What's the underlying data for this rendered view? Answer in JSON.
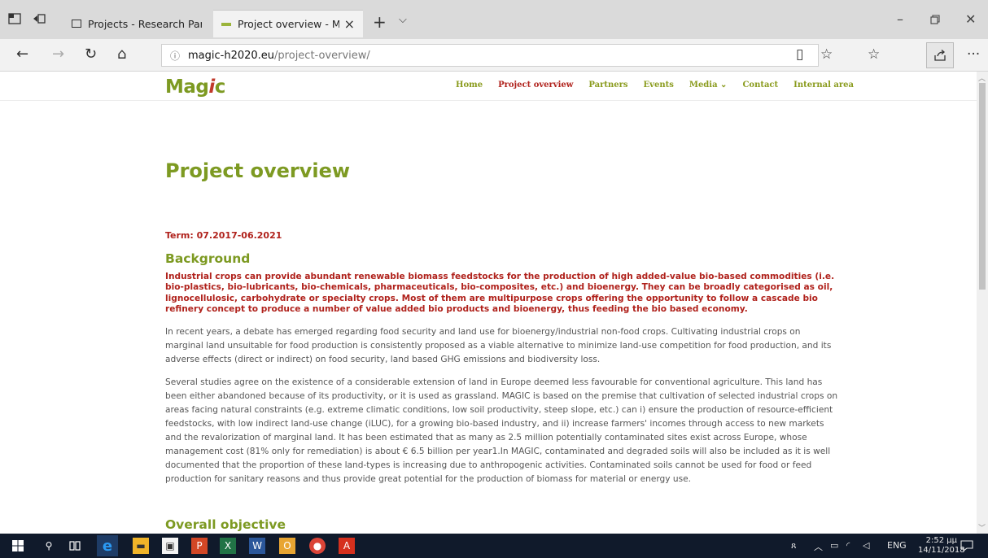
{
  "browser": {
    "tabs": [
      {
        "label": "Projects - Research Participa",
        "active": false
      },
      {
        "label": "Project overview - Mag",
        "active": true
      }
    ],
    "address": {
      "host": "magic-h2020.eu",
      "path": "/project-overview/"
    }
  },
  "site": {
    "logo": {
      "text_a": "Ma",
      "text_g": "g",
      "text_i": "i",
      "text_c": "c"
    },
    "nav": [
      {
        "label": "Home"
      },
      {
        "label": "Project overview"
      },
      {
        "label": "Partners"
      },
      {
        "label": "Events"
      },
      {
        "label": "Media ⌄"
      },
      {
        "label": "Contact"
      },
      {
        "label": "Internal area"
      }
    ]
  },
  "page": {
    "title": "Project overview",
    "term": "Term: 07.2017-06.2021",
    "background_heading": "Background",
    "lead": "Industrial crops can provide abundant renewable biomass feedstocks for the production of high added-value bio-based commodities (i.e. bio-plastics, bio-lubricants, bio-chemicals, pharmaceuticals, bio-composites, etc.) and bioenergy. They can be broadly categorised as oil, lignocellulosic, carbohydrate or specialty crops. Most of them are multipurpose crops offering the opportunity to follow a cascade bio refinery concept to produce a number of value added bio products and bioenergy, thus feeding the bio based economy.",
    "paragraph1": "In recent years, a debate has emerged regarding food security and land use for bioenergy/industrial non-food crops. Cultivating industrial crops on marginal land unsuitable for food production is consistently proposed as a viable alternative to minimize land-use competition for food production, and its adverse effects (direct or indirect) on food security, land based GHG emissions and biodiversity loss.",
    "paragraph2": "Several studies agree on the existence of a considerable extension of land in Europe deemed less favourable for conventional agriculture. This land has been either abandoned because of its productivity, or it is used as grassland. MAGIC is based on the premise that cultivation of selected industrial crops on areas facing natural constraints (e.g. extreme climatic conditions, low soil productivity, steep slope, etc.) can i) ensure the production of resource-efficient feedstocks, with low indirect land-use change (iLUC), for a growing bio-based industry, and ii) increase farmers' incomes through access to new markets and the revalorization of marginal land. It has been estimated that as many as 2.5 million potentially contaminated sites exist across Europe, whose management cost (81% only for remediation) is about € 6.5 billion per year1.In MAGIC, contaminated and degraded soils will also be included as it is well documented that the proportion of these land-types is increasing due to anthropogenic activities. Contaminated soils cannot be used for food or feed production for sanitary reasons and thus provide great potential for the production of biomass for material or energy use.",
    "objective_heading": "Overall objective"
  },
  "taskbar": {
    "language": "ENG",
    "time": "2:52 μμ",
    "date": "14/11/2018"
  },
  "colors": {
    "brand_green": "#7d9a22",
    "accent_red": "#b0221c",
    "taskbar": "#101a2b"
  }
}
